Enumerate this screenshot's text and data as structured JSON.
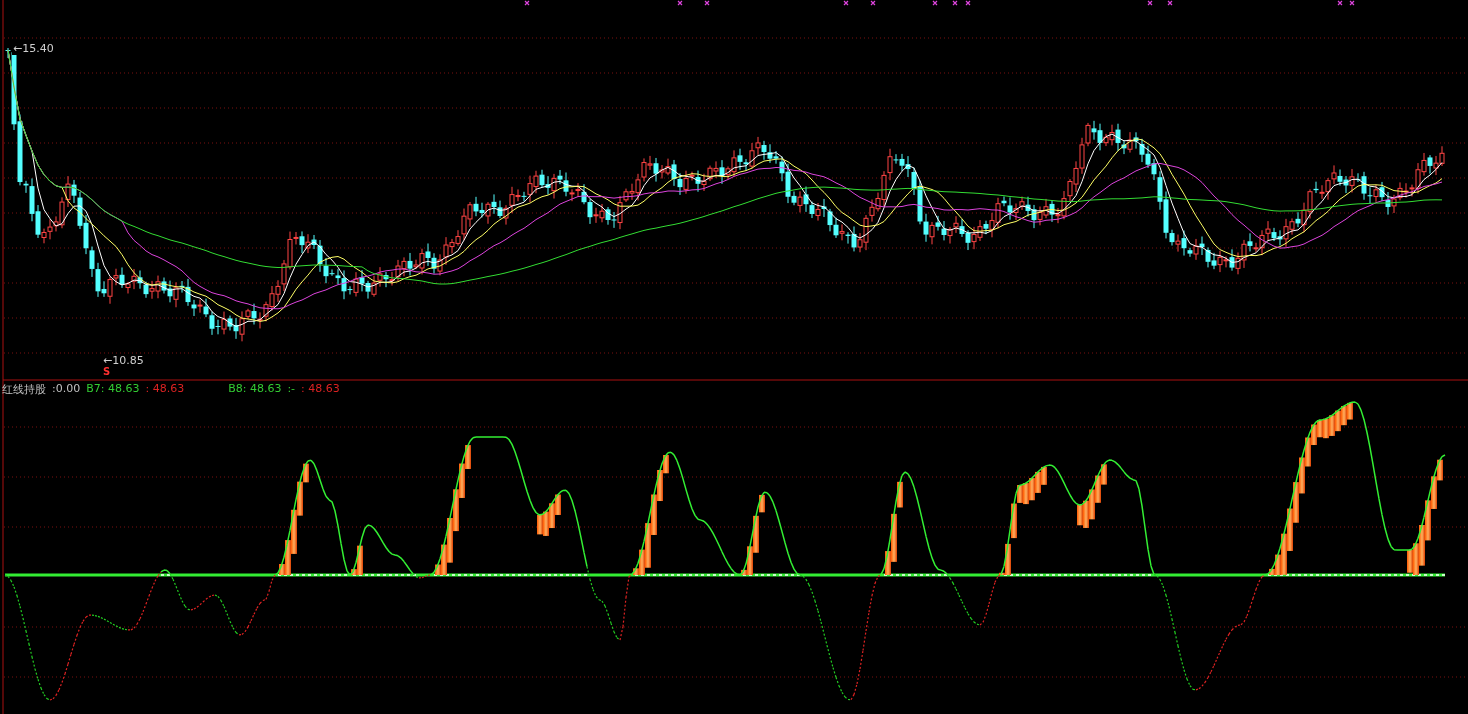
{
  "price_chart": {
    "high_label": "←15.40",
    "low_label": "←10.85",
    "signal": "S"
  },
  "indicator": {
    "legend": [
      {
        "text": "红线持股",
        "kind": "label"
      },
      {
        "text": ":0.00",
        "kind": "label"
      },
      {
        "text": "B7: 48.63",
        "kind": "positive"
      },
      {
        "text": ": 48.63",
        "kind": "negative"
      },
      {
        "text": "B8: 48.63",
        "kind": "positive"
      },
      {
        "text": ":-",
        "kind": "positive"
      },
      {
        "text": ": 48.63",
        "kind": "negative"
      }
    ]
  }
}
